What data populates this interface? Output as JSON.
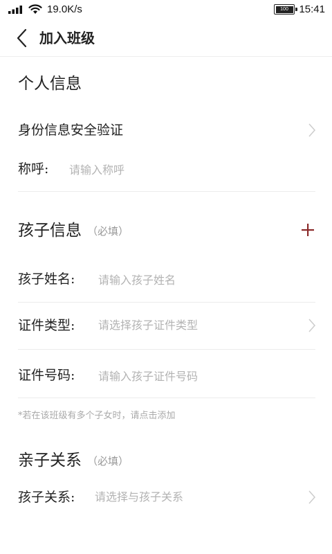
{
  "status_bar": {
    "speed": "19.0K/s",
    "battery": "100",
    "time": "15:41"
  },
  "nav": {
    "title": "加入班级"
  },
  "personal": {
    "title": "个人信息",
    "verify_label": "身份信息安全验证",
    "name_label": "称呼:",
    "name_placeholder": "请输入称呼"
  },
  "child": {
    "title": "孩子信息",
    "required": "（必填）",
    "name_label": "孩子姓名:",
    "name_placeholder": "请输入孩子姓名",
    "id_type_label": "证件类型:",
    "id_type_placeholder": "请选择孩子证件类型",
    "id_number_label": "证件号码:",
    "id_number_placeholder": "请输入孩子证件号码",
    "hint": "*若在该班级有多个子女时，请点击添加"
  },
  "relation": {
    "title": "亲子关系",
    "required": "（必填）",
    "label": "孩子关系:",
    "placeholder": "请选择与孩子关系"
  },
  "colors": {
    "accent": "#8b2a2a",
    "placeholder": "#b3b3b3",
    "divider": "#ececec"
  }
}
